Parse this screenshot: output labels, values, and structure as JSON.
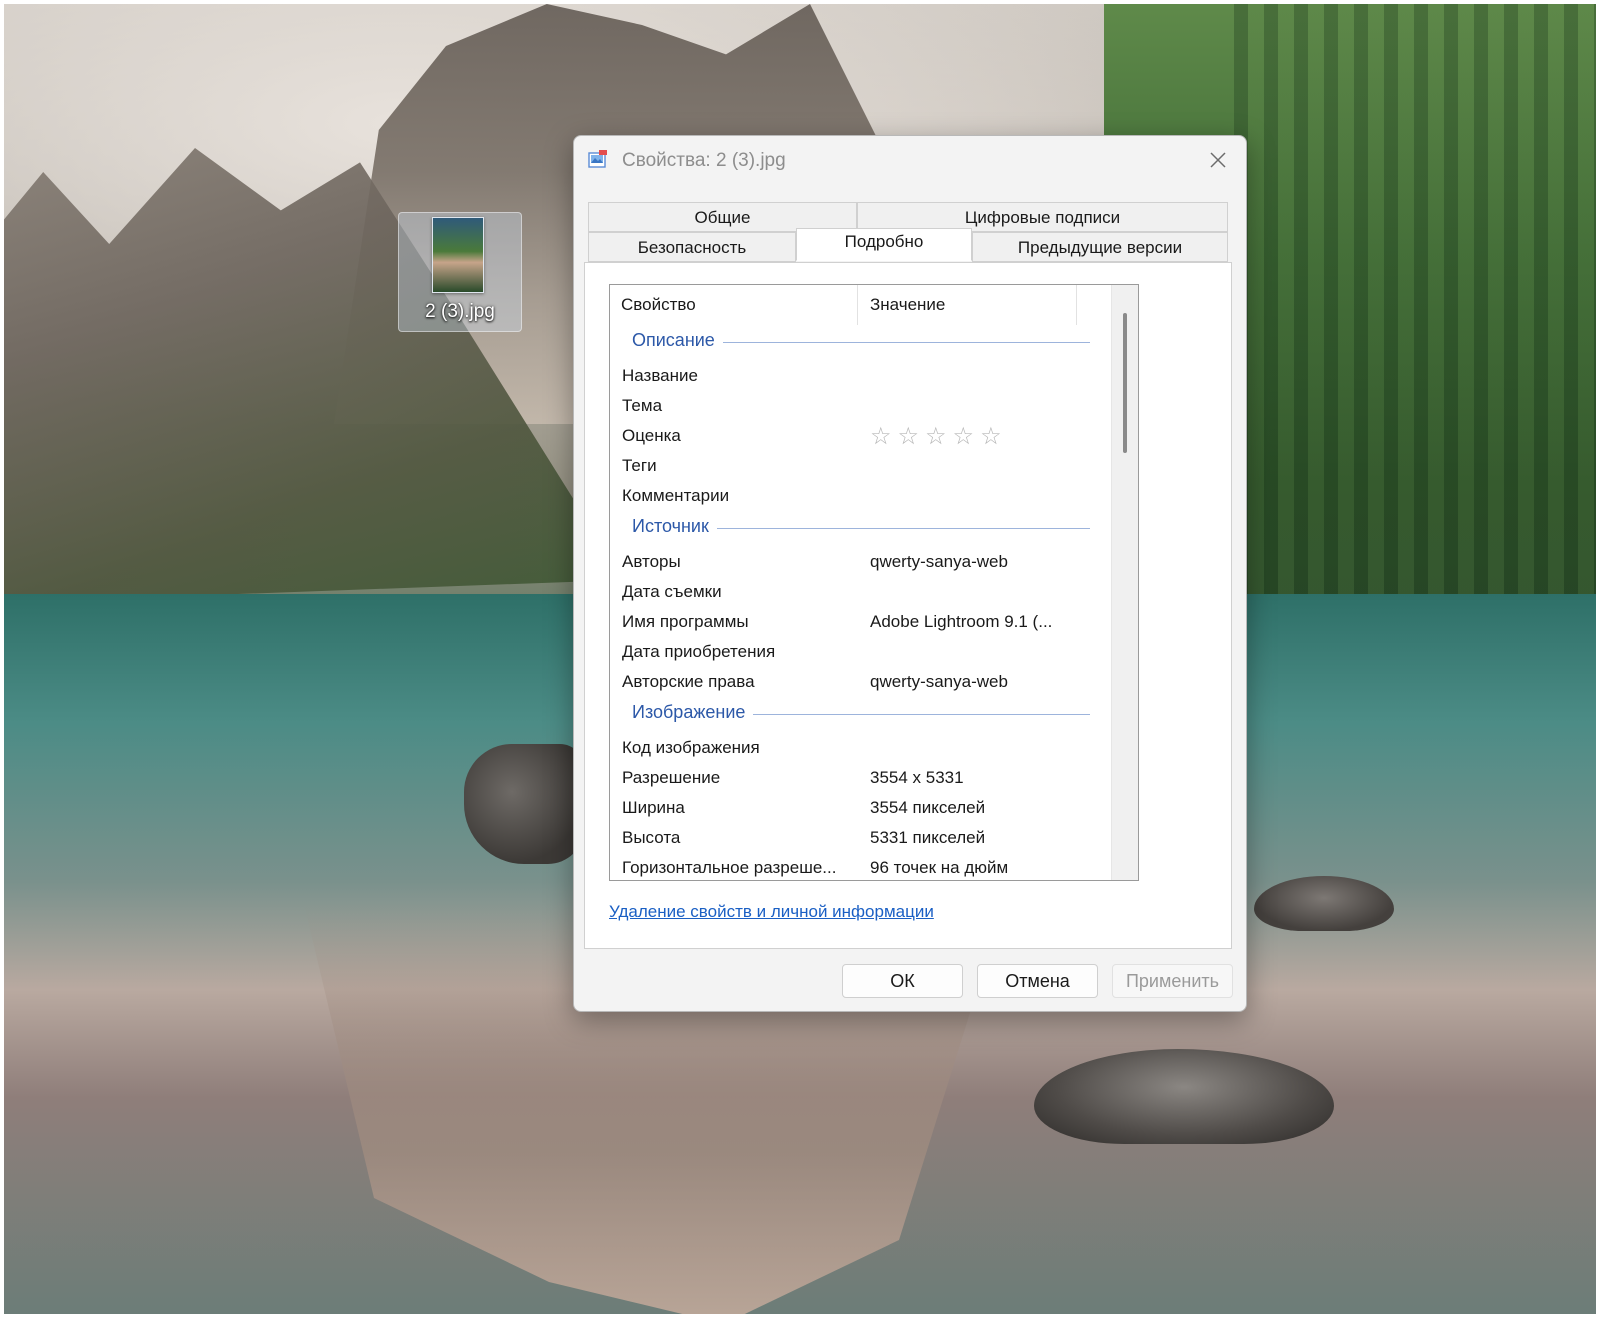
{
  "desktop": {
    "file_label": "2 (3).jpg"
  },
  "dialog": {
    "title": "Свойства: 2 (3).jpg",
    "tabs_top": [
      "Общие",
      "Цифровые подписи"
    ],
    "tabs_bottom": [
      "Безопасность",
      "Подробно",
      "Предыдущие версии"
    ],
    "active_tab": "Подробно",
    "columns": {
      "property": "Свойство",
      "value": "Значение"
    },
    "groups": [
      {
        "title": "Описание",
        "rows": [
          {
            "key": "Название",
            "value": ""
          },
          {
            "key": "Тема",
            "value": ""
          },
          {
            "key": "Оценка",
            "value": "",
            "rating": 0,
            "rating_max": 5
          },
          {
            "key": "Теги",
            "value": ""
          },
          {
            "key": "Комментарии",
            "value": ""
          }
        ]
      },
      {
        "title": "Источник",
        "rows": [
          {
            "key": "Авторы",
            "value": "qwerty-sanya-web"
          },
          {
            "key": "Дата съемки",
            "value": ""
          },
          {
            "key": "Имя программы",
            "value": "Adobe Lightroom 9.1 (..."
          },
          {
            "key": "Дата приобретения",
            "value": ""
          },
          {
            "key": "Авторские права",
            "value": "qwerty-sanya-web"
          }
        ]
      },
      {
        "title": "Изображение",
        "rows": [
          {
            "key": "Код изображения",
            "value": ""
          },
          {
            "key": "Разрешение",
            "value": "3554 x 5331"
          },
          {
            "key": "Ширина",
            "value": "3554 пикселей"
          },
          {
            "key": "Высота",
            "value": "5331 пикселей"
          },
          {
            "key": "Горизонтальное разреше...",
            "value": "96 точек на дюйм"
          }
        ]
      }
    ],
    "remove_link": "Удаление свойств и личной информации",
    "buttons": {
      "ok": "ОК",
      "cancel": "Отмена",
      "apply": "Применить"
    },
    "colors": {
      "group_title": "#2c58a8",
      "link": "#1a5fc4",
      "disabled_text": "#9a9a9a"
    }
  }
}
